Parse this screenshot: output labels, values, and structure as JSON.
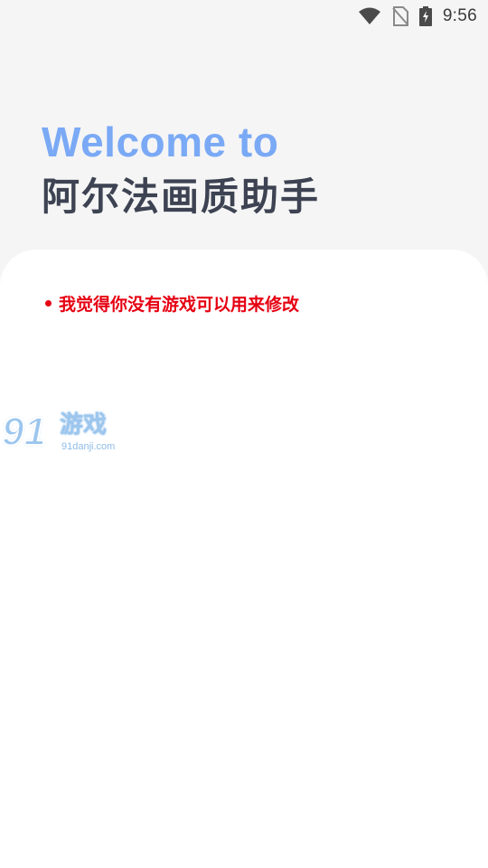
{
  "status_bar": {
    "time": "9:56",
    "icons": [
      "wifi-icon",
      "no-sim-icon",
      "battery-charging-icon"
    ]
  },
  "hero": {
    "welcome": "Welcome to",
    "app_name": "阿尔法画质助手"
  },
  "notice": {
    "text": "我觉得你没有游戏可以用来修改",
    "color": "#e60012"
  },
  "watermark": {
    "number": "91",
    "brand": "游戏",
    "url": "91danji.com"
  },
  "colors": {
    "accent": "#7aa9f5",
    "title": "#3d4352",
    "background": "#f5f5f5",
    "card": "#ffffff"
  }
}
